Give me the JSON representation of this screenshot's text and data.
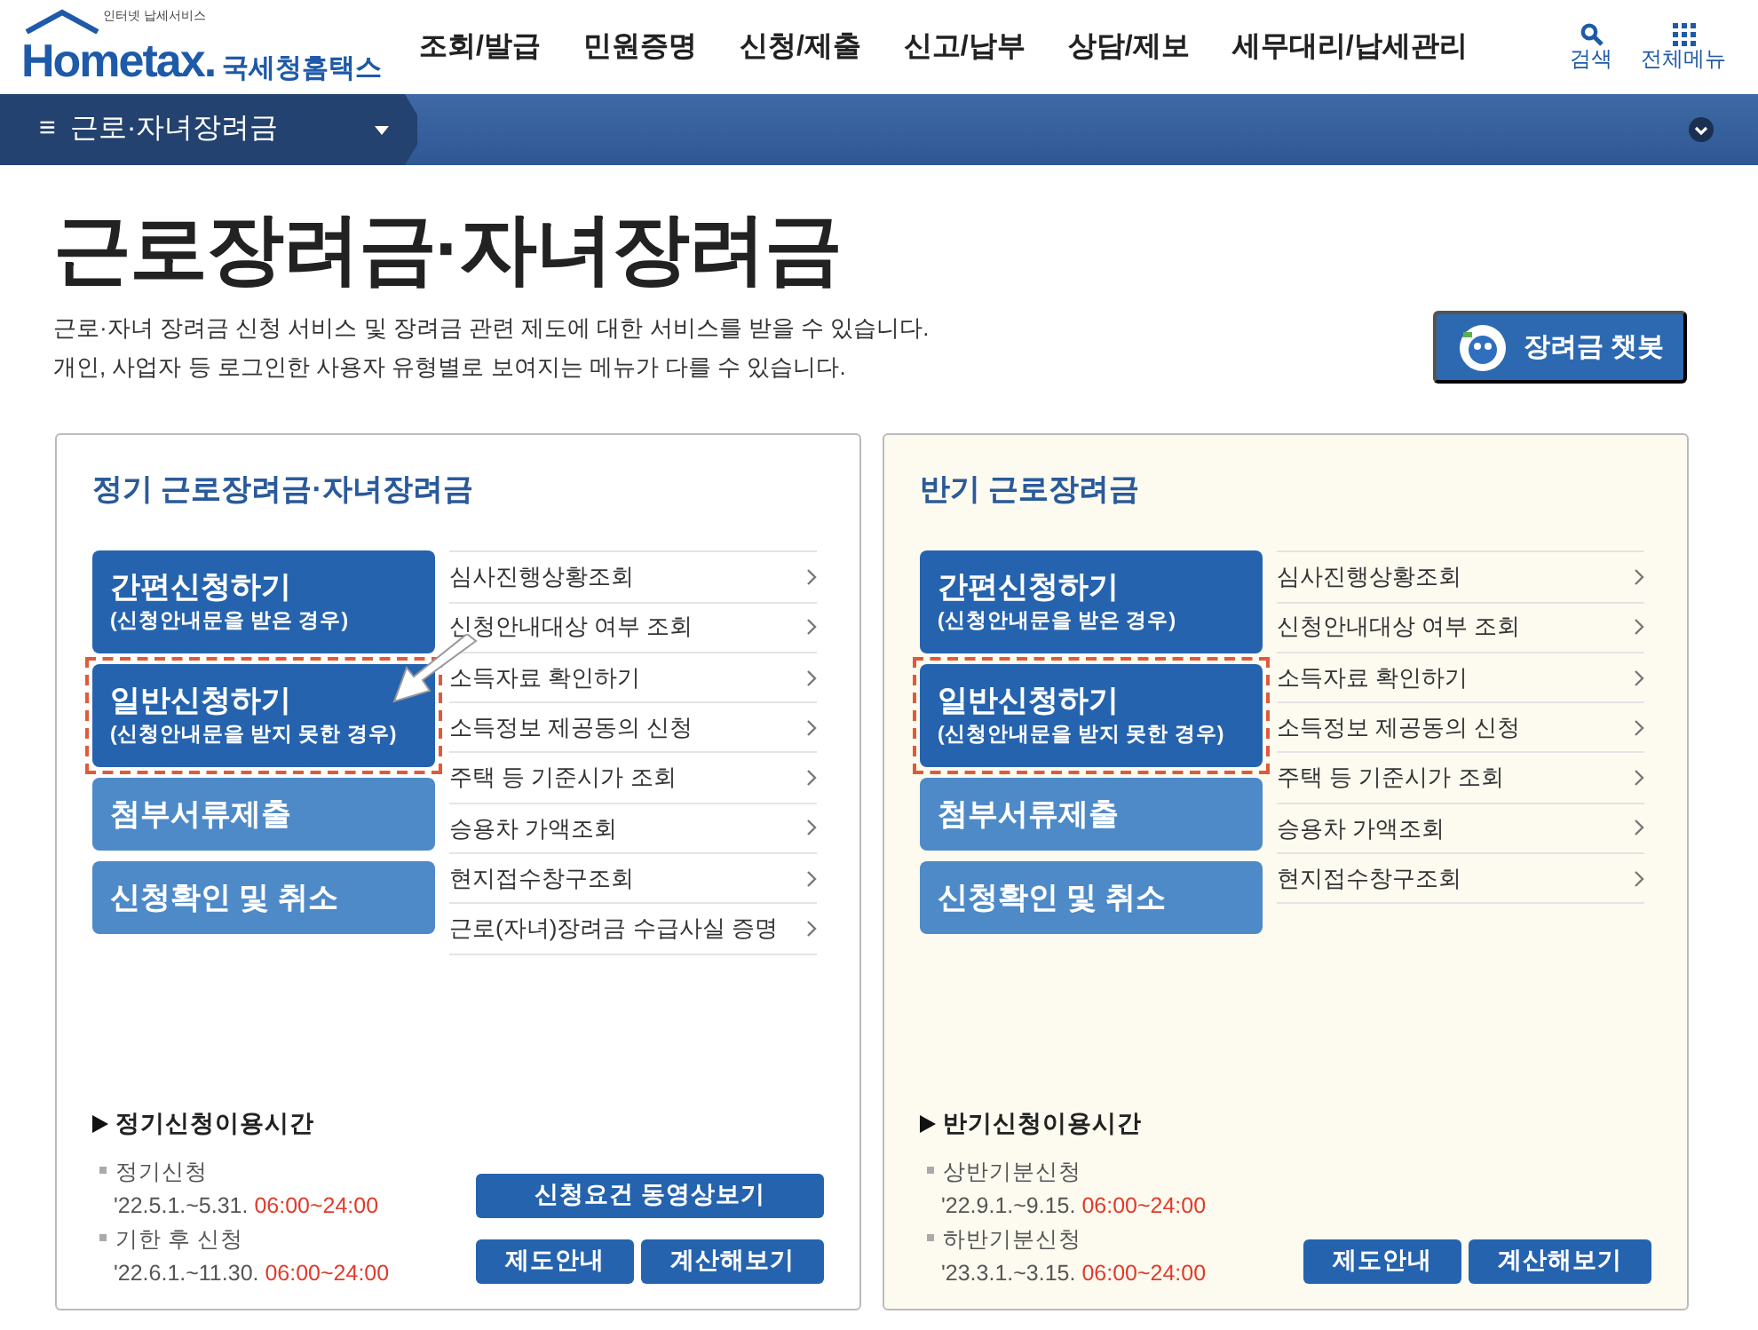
{
  "header": {
    "logo_small": "인터넷 납세서비스",
    "logo_text": "Hometax.",
    "logo_korean": "국세청홈택스",
    "menu": [
      "조회/발급",
      "민원증명",
      "신청/제출",
      "신고/납부",
      "상담/제보",
      "세무대리/납세관리"
    ],
    "search_label": "검색",
    "all_menu_label": "전체메뉴"
  },
  "breadcrumb": {
    "menu_glyph": "≡",
    "label": "근로·자녀장려금"
  },
  "page": {
    "title": "근로장려금·자녀장려금",
    "description": [
      "근로·자녀 장려금 신청 서비스 및 장려금 관련 제도에 대한 서비스를 받을 수 있습니다.",
      "개인, 사업자 등 로그인한 사용자 유형별로 보여지는 메뉴가 다를 수 있습니다."
    ],
    "chatbot_label": "장려금 챗봇"
  },
  "panels": [
    {
      "kind": "regular",
      "title": "정기 근로장려금·자녀장려금",
      "actions": [
        {
          "kind": "dark",
          "title": "간편신청하기",
          "subtitle": "(신청안내문을 받은 경우)",
          "highlighted": false
        },
        {
          "kind": "dark",
          "title": "일반신청하기",
          "subtitle": "(신청안내문을 받지 못한 경우)",
          "highlighted": true
        },
        {
          "kind": "light",
          "title": "첨부서류제출",
          "highlighted": false
        },
        {
          "kind": "light",
          "title": "신청확인 및 취소",
          "highlighted": false
        }
      ],
      "links": [
        "심사진행상황조회",
        "신청안내대상 여부 조회",
        "소득자료 확인하기",
        "소득정보 제공동의 신청",
        "주택 등 기준시가 조회",
        "승용차 가액조회",
        "현지접수창구조회",
        "근로(자녀)장려금 수급사실 증명"
      ],
      "schedule": {
        "heading": "정기신청이용시간",
        "items": [
          {
            "label": "정기신청",
            "dates": "'22.5.1.~5.31.",
            "time": "06:00~24:00"
          },
          {
            "label": "기한 후 신청",
            "dates": "'22.6.1.~11.30.",
            "time": "06:00~24:00"
          }
        ]
      },
      "button_rows": [
        [
          "신청요건 동영상보기"
        ],
        [
          "제도안내",
          "계산해보기"
        ]
      ]
    },
    {
      "kind": "half",
      "title": "반기 근로장려금",
      "actions": [
        {
          "kind": "dark",
          "title": "간편신청하기",
          "subtitle": "(신청안내문을 받은 경우)",
          "highlighted": false
        },
        {
          "kind": "dark",
          "title": "일반신청하기",
          "subtitle": "(신청안내문을 받지 못한 경우)",
          "highlighted": true
        },
        {
          "kind": "light",
          "title": "첨부서류제출",
          "highlighted": false
        },
        {
          "kind": "light",
          "title": "신청확인 및 취소",
          "highlighted": false
        }
      ],
      "links": [
        "심사진행상황조회",
        "신청안내대상 여부 조회",
        "소득자료 확인하기",
        "소득정보 제공동의 신청",
        "주택 등 기준시가 조회",
        "승용차 가액조회",
        "현지접수창구조회"
      ],
      "schedule": {
        "heading": "반기신청이용시간",
        "items": [
          {
            "label": "상반기분신청",
            "dates": "'22.9.1.~9.15.",
            "time": "06:00~24:00"
          },
          {
            "label": "하반기분신청",
            "dates": "'23.3.1.~3.15.",
            "time": "06:00~24:00"
          }
        ]
      },
      "button_rows": [
        [
          "제도안내",
          "계산해보기"
        ]
      ]
    }
  ]
}
